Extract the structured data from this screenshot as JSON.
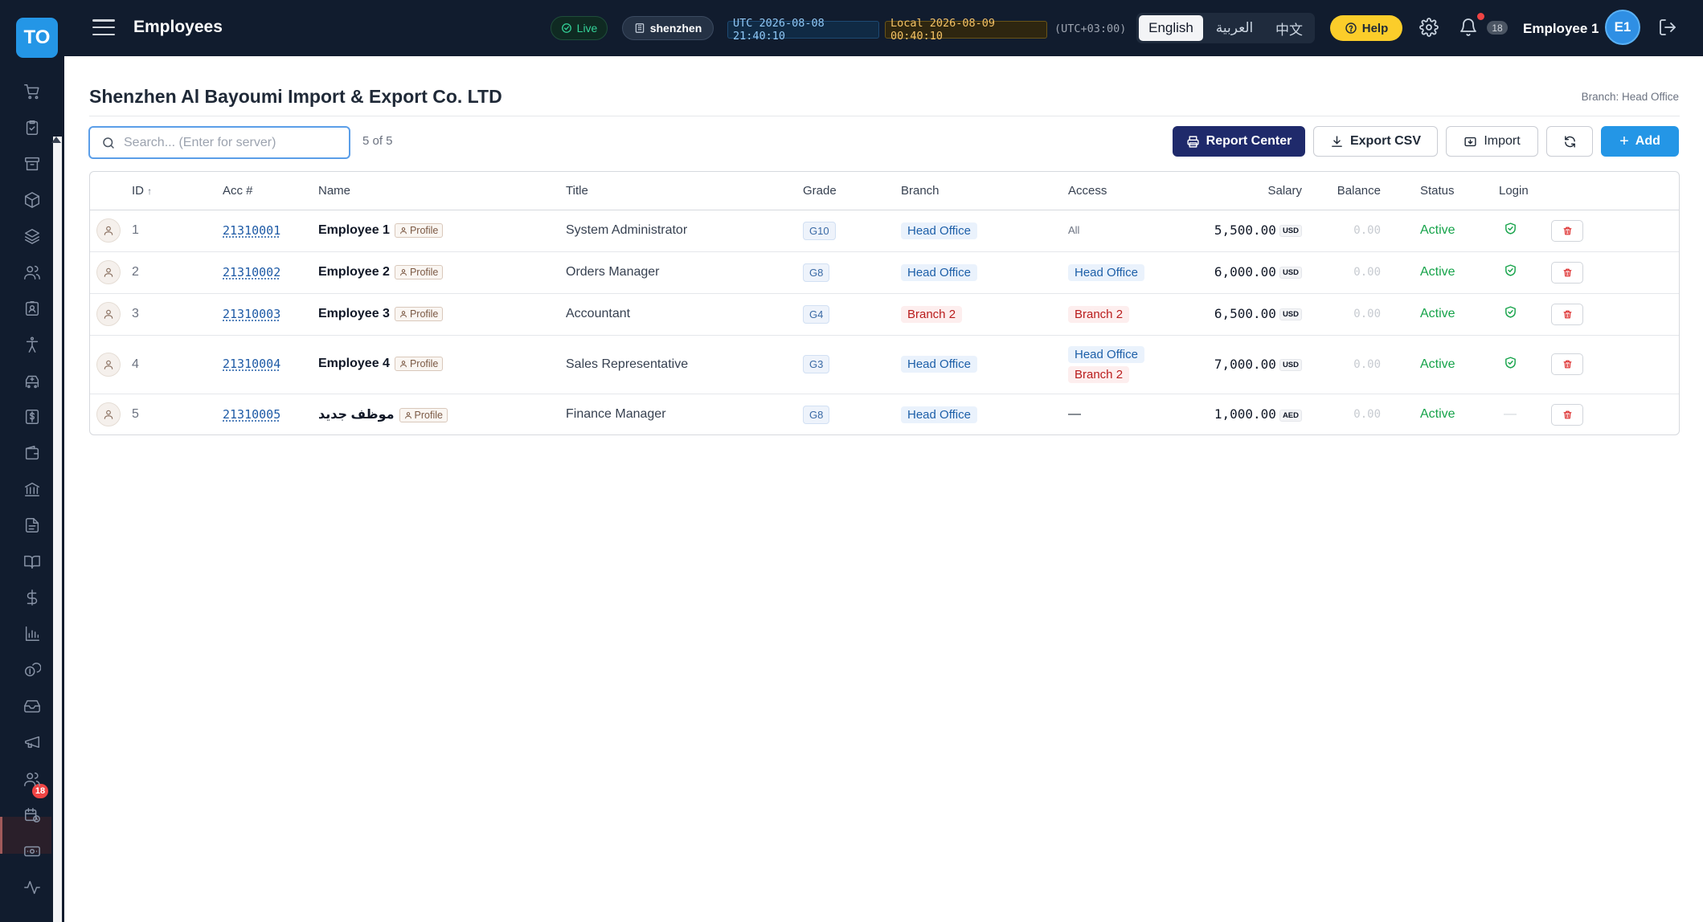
{
  "app": {
    "logo_text": "TO",
    "page_title": "Employees"
  },
  "header": {
    "live_label": "Live",
    "server_label": "shenzhen",
    "utc_clock": "UTC 2026-08-08 21:40:10",
    "local_clock": "Local 2026-08-09 00:40:10",
    "tz_offset": "(UTC+03:00)",
    "languages": [
      "English",
      "العربية",
      "中文"
    ],
    "active_language": "English",
    "help_label": "Help",
    "notification_count": "18",
    "user_name": "Employee 1",
    "user_initials": "E1"
  },
  "sidebar": {
    "icons": [
      "cart-icon",
      "clipboard-check-icon",
      "archive-icon",
      "package-icon",
      "layers-icon",
      "users-icon",
      "id-badge-icon",
      "accessibility-icon",
      "ambulance-icon",
      "receipt-dollar-icon",
      "wallet-icon",
      "bank-icon",
      "document-icon",
      "book-icon",
      "dollar-icon",
      "bar-chart-icon",
      "coins-icon",
      "inbox-icon",
      "megaphone-icon",
      "employees-icon",
      "calendar-clock-icon",
      "cash-icon",
      "activity-icon"
    ],
    "badge_count": "18",
    "active_item": "employees-icon"
  },
  "main": {
    "company_name": "Shenzhen Al Bayoumi Import & Export Co. LTD",
    "branch_label": "Branch: Head Office",
    "search_placeholder": "Search... (Enter for server)",
    "result_count": "5 of 5",
    "buttons": {
      "report_center": "Report Center",
      "export_csv": "Export CSV",
      "import": "Import",
      "add": "Add"
    }
  },
  "table": {
    "columns": [
      "ID",
      "Acc #",
      "Name",
      "Title",
      "Grade",
      "Branch",
      "Access",
      "Salary",
      "Balance",
      "Status",
      "Login"
    ],
    "sort_indicator": "↑",
    "profile_label": "Profile",
    "rows": [
      {
        "id": "1",
        "acc": "21310001",
        "name": "Employee 1",
        "title": "System Administrator",
        "grade": "G10",
        "branch": "Head Office",
        "branch_color": "#1d5fa8",
        "access": [
          "All"
        ],
        "access_type": "all",
        "salary": "5,500.00",
        "currency": "USD",
        "balance": "0.00",
        "status": "Active",
        "login": true
      },
      {
        "id": "2",
        "acc": "21310002",
        "name": "Employee 2",
        "title": "Orders Manager",
        "grade": "G8",
        "branch": "Head Office",
        "branch_color": "#1d5fa8",
        "access": [
          "Head Office"
        ],
        "access_type": "tags",
        "salary": "6,000.00",
        "currency": "USD",
        "balance": "0.00",
        "status": "Active",
        "login": true
      },
      {
        "id": "3",
        "acc": "21310003",
        "name": "Employee 3",
        "title": "Accountant",
        "grade": "G4",
        "branch": "Branch 2",
        "branch_color": "#b91c1c",
        "access": [
          "Branch 2"
        ],
        "access_type": "tags",
        "salary": "6,500.00",
        "currency": "USD",
        "balance": "0.00",
        "status": "Active",
        "login": true
      },
      {
        "id": "4",
        "acc": "21310004",
        "name": "Employee 4",
        "title": "Sales Representative",
        "grade": "G3",
        "branch": "Head Office",
        "branch_color": "#1d5fa8",
        "access": [
          "Head Office",
          "Branch 2"
        ],
        "access_type": "tags",
        "salary": "7,000.00",
        "currency": "USD",
        "balance": "0.00",
        "status": "Active",
        "login": true
      },
      {
        "id": "5",
        "acc": "21310005",
        "name": "موظف جديد",
        "title": "Finance Manager",
        "grade": "G8",
        "branch": "Head Office",
        "branch_color": "#1d5fa8",
        "access": [
          "—"
        ],
        "access_type": "none",
        "salary": "1,000.00",
        "currency": "AED",
        "balance": "0.00",
        "status": "Active",
        "login": false,
        "login_text": "—"
      }
    ]
  },
  "colors": {
    "topbar_bg": "#111c2e",
    "accent_blue": "#2496e6",
    "report_btn": "#1f2a6b",
    "help_yellow": "#fbcd2a",
    "status_green": "#16a34a",
    "notification_red": "#ef4444"
  }
}
